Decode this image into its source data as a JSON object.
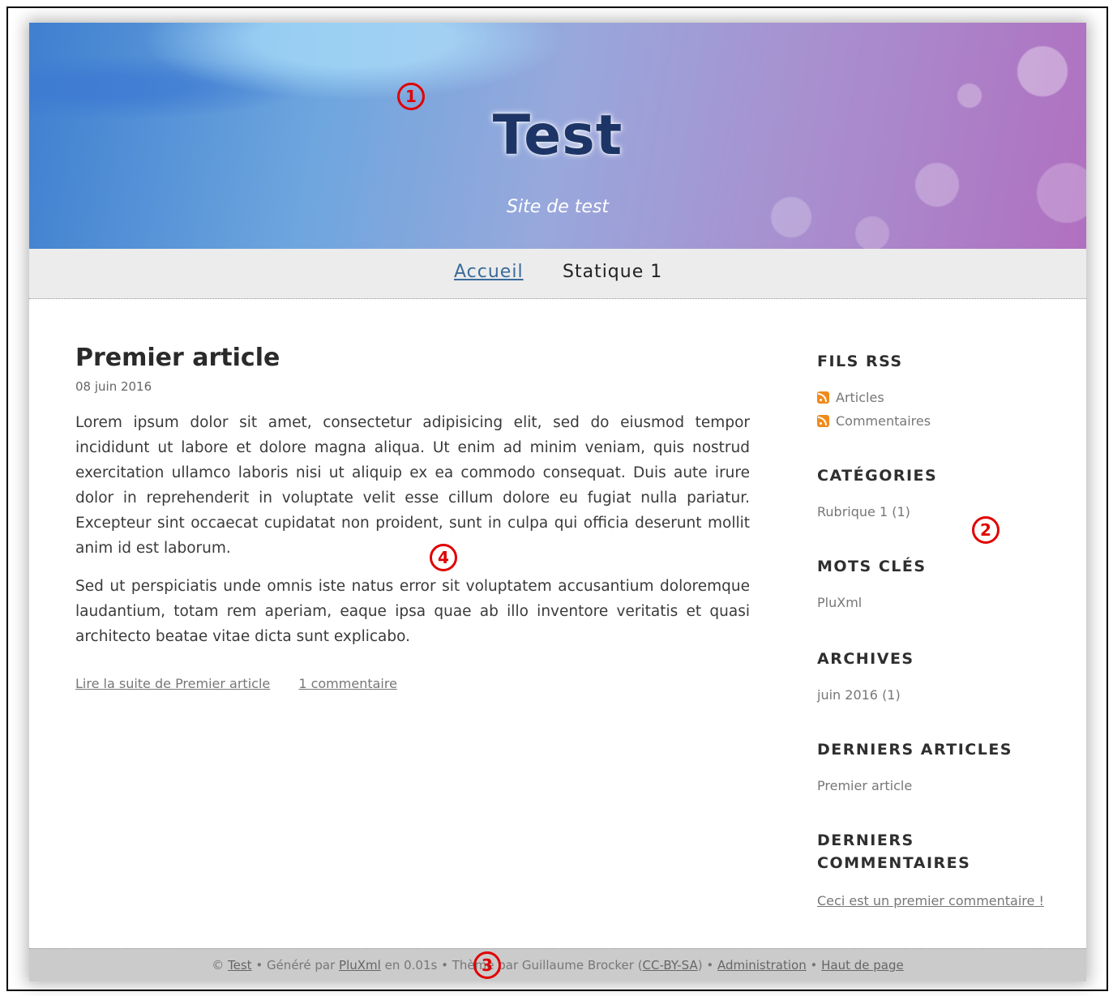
{
  "header": {
    "title": "Test",
    "subtitle": "Site de test"
  },
  "nav": {
    "items": [
      {
        "label": "Accueil",
        "active": true
      },
      {
        "label": "Statique 1",
        "active": false
      }
    ]
  },
  "article": {
    "title": "Premier article",
    "date": "08 juin 2016",
    "paragraphs": [
      "Lorem ipsum dolor sit amet, consectetur adipisicing elit, sed do eiusmod tempor incididunt ut labore et dolore magna aliqua. Ut enim ad minim veniam, quis nostrud exercitation ullamco laboris nisi ut aliquip ex ea commodo consequat. Duis aute irure dolor in reprehenderit in voluptate velit esse cillum dolore eu fugiat nulla pariatur. Excepteur sint occaecat cupidatat non proident, sunt in culpa qui officia deserunt mollit anim id est laborum.",
      "Sed ut perspiciatis unde omnis iste natus error sit voluptatem accusantium doloremque laudantium, totam rem aperiam, eaque ipsa quae ab illo inventore veritatis et quasi architecto beatae vitae dicta sunt explicabo."
    ],
    "read_more": "Lire la suite de Premier article",
    "comments_link": "1 commentaire"
  },
  "sidebar": {
    "rss": {
      "title": "FILS RSS",
      "items": [
        "Articles",
        "Commentaires"
      ]
    },
    "categories": {
      "title": "CATÉGORIES",
      "items": [
        "Rubrique 1 (1)"
      ]
    },
    "tags": {
      "title": "MOTS CLÉS",
      "items": [
        "PluXml"
      ]
    },
    "archives": {
      "title": "ARCHIVES",
      "items": [
        "juin 2016 (1)"
      ]
    },
    "latest_articles": {
      "title": "DERNIERS ARTICLES",
      "items": [
        "Premier article"
      ]
    },
    "latest_comments": {
      "title_line1": "DERNIERS",
      "title_line2": "COMMENTAIRES",
      "items": [
        "Ceci est un premier commentaire !"
      ]
    }
  },
  "footer": {
    "copyright": "©",
    "site_link": "Test",
    "generated_by": "• Généré par",
    "pluxml_link": "PluXml",
    "time_text": "en 0.01s • Thème",
    "theme_by": "par Guillaume Brocker (",
    "license_link": "CC-BY-SA",
    "after_license": ") •",
    "admin_link": "Administration",
    "sep": "•",
    "top_link": "Haut de page"
  },
  "annotations": [
    "1",
    "2",
    "3",
    "4"
  ],
  "colors": {
    "annotation": "#e00000",
    "nav_bg": "#ececec",
    "footer_bg": "#cbcbcb",
    "title": "#1d3566"
  }
}
